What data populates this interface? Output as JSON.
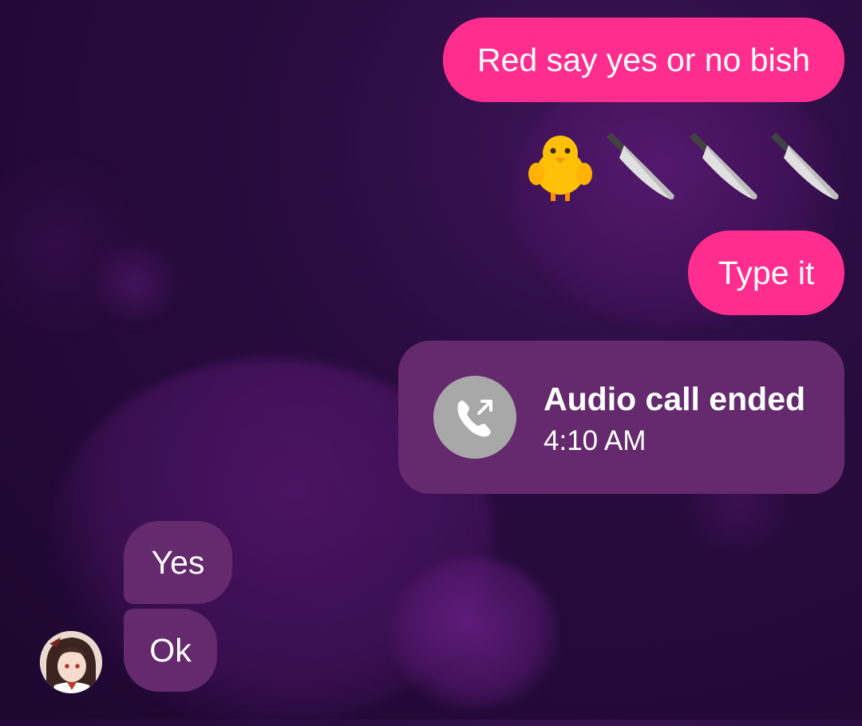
{
  "messages": {
    "outgoing_1": "Red say yes or no bish",
    "emoji_row": [
      "chick-emoji",
      "kitchen-knife-emoji",
      "kitchen-knife-emoji",
      "kitchen-knife-emoji"
    ],
    "outgoing_2": "Type it",
    "call": {
      "title": "Audio call ended",
      "time": "4:10 AM",
      "icon": "phone-outgoing-icon"
    },
    "incoming_1": "Yes",
    "incoming_2": "Ok"
  },
  "colors": {
    "outgoing_bubble": "#ff2d8e",
    "incoming_bubble": "#652a6d",
    "call_icon_bg": "#a8a8a8",
    "background": "#2a0c40"
  }
}
